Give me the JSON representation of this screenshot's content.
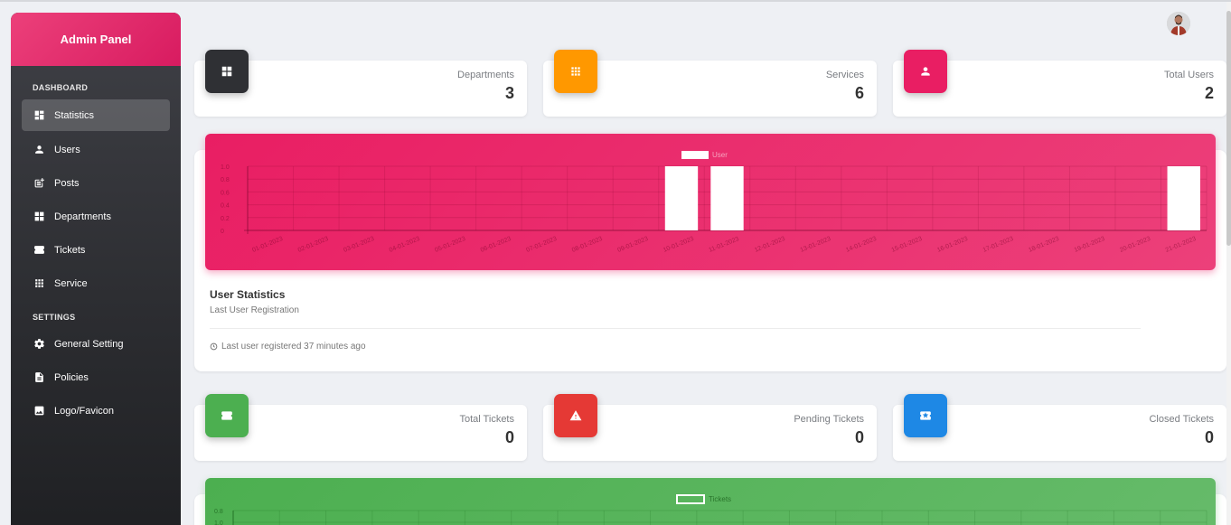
{
  "sidebar": {
    "brand": "Admin Panel",
    "sections": [
      {
        "title": "DASHBOARD"
      },
      {
        "title": "SETTINGS"
      }
    ],
    "items": [
      {
        "label": "Statistics",
        "icon": "dashboard-icon",
        "active": true
      },
      {
        "label": "Users",
        "icon": "user-icon"
      },
      {
        "label": "Posts",
        "icon": "post-add-icon"
      },
      {
        "label": "Departments",
        "icon": "dashboard-icon"
      },
      {
        "label": "Tickets",
        "icon": "ticket-icon"
      },
      {
        "label": "Service",
        "icon": "grid-icon"
      },
      {
        "label": "General Setting",
        "icon": "gear-icon"
      },
      {
        "label": "Policies",
        "icon": "document-icon"
      },
      {
        "label": "Logo/Favicon",
        "icon": "image-icon"
      }
    ]
  },
  "stats_top": [
    {
      "label": "Departments",
      "value": "3",
      "color": "#2f3034",
      "icon": "dashboard-icon"
    },
    {
      "label": "Services",
      "value": "6",
      "color": "#ff9800",
      "icon": "grid-icon"
    },
    {
      "label": "Total Users",
      "value": "2",
      "color": "#e91e63",
      "icon": "user-icon"
    }
  ],
  "stats_bottom": [
    {
      "label": "Total Tickets",
      "value": "0",
      "color": "#4caf50",
      "icon": "ticket-icon"
    },
    {
      "label": "Pending Tickets",
      "value": "0",
      "color": "#e53935",
      "icon": "warning-icon"
    },
    {
      "label": "Closed Tickets",
      "value": "0",
      "color": "#1e88e5",
      "icon": "star-ticket-icon"
    }
  ],
  "user_card": {
    "title": "User Statistics",
    "subtitle": "Last User Registration",
    "footer": "Last user registered 37 minutes ago"
  },
  "chart_data": [
    {
      "type": "bar",
      "legend": "User",
      "color": "#e91e63",
      "categories": [
        "01-01-2023",
        "02-01-2023",
        "03-01-2023",
        "04-01-2023",
        "05-01-2023",
        "06-01-2023",
        "07-01-2023",
        "08-01-2023",
        "09-01-2023",
        "10-01-2023",
        "11-01-2023",
        "12-01-2023",
        "13-01-2023",
        "14-01-2023",
        "15-01-2023",
        "16-01-2023",
        "17-01-2023",
        "18-01-2023",
        "19-01-2023",
        "20-01-2023",
        "21-01-2023"
      ],
      "values": [
        0,
        0,
        0,
        0,
        0,
        0,
        0,
        0,
        0,
        1,
        1,
        0,
        0,
        0,
        0,
        0,
        0,
        0,
        0,
        0,
        1
      ],
      "yticks": [
        "0",
        "0.2",
        "0.4",
        "0.6",
        "0.8",
        "1.0"
      ],
      "ylim": [
        0,
        1
      ],
      "grid": true
    },
    {
      "type": "bar",
      "legend": "Tickets",
      "color": "#4caf50",
      "yticks": [
        "0.8",
        "1.0"
      ],
      "grid": true
    }
  ]
}
